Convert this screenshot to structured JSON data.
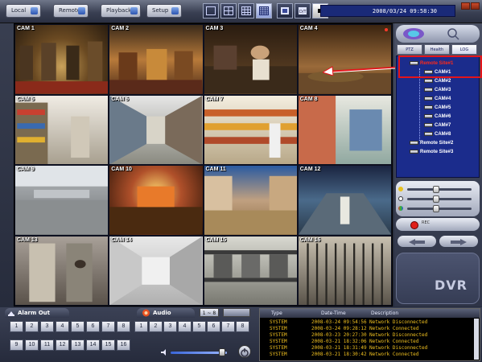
{
  "toolbar": {
    "mode_buttons": [
      "Local",
      "Remote",
      "Playback",
      "Setup"
    ],
    "datetime": "2008/03/24 09:58:30"
  },
  "cameras": [
    "CAM 1",
    "CAM 2",
    "CAM 3",
    "CAM 4",
    "CAM 5",
    "CAM 6",
    "CAM 7",
    "CAM 8",
    "CAM 9",
    "CAM 10",
    "CAM 11",
    "CAM 12",
    "CAM 13",
    "CAM 14",
    "CAM 15",
    "CAM 16"
  ],
  "panel": {
    "tabs": [
      "PTZ",
      "Health Check",
      "LOG"
    ],
    "tree": {
      "root": "Remote Site#1",
      "cams": [
        "CAM#1",
        "CAM#2",
        "CAM#3",
        "CAM#4",
        "CAM#5",
        "CAM#6",
        "CAM#7",
        "CAM#8"
      ],
      "other_sites": [
        "Remote Site#2",
        "Remote Site#3"
      ]
    },
    "sliders": [
      0.45,
      0.45,
      0.45
    ],
    "rec_label": "REC",
    "brand": "DVR"
  },
  "bottom": {
    "alarm_title": "Alarm Out",
    "audio_title": "Audio",
    "page_label": "1 ~ 8",
    "alarm_buttons_row1": [
      "1",
      "2",
      "3",
      "4",
      "5",
      "6",
      "7",
      "8"
    ],
    "alarm_buttons_row2": [
      "9",
      "10",
      "11",
      "12",
      "13",
      "14",
      "15",
      "16"
    ],
    "audio_buttons": [
      "1",
      "2",
      "3",
      "4",
      "5",
      "6",
      "7",
      "8"
    ],
    "audio_volume": 0.92
  },
  "log": {
    "headers": [
      "Type",
      "Date-Time",
      "Description"
    ],
    "rows": [
      [
        "SYSTEM",
        "2008-03-24 09:54:56",
        "Network Disconnected"
      ],
      [
        "SYSTEM",
        "2008-03-24 09:28:12",
        "Network Connected"
      ],
      [
        "SYSTEM",
        "2008-03-23 20:27:30",
        "Network Disconnected"
      ],
      [
        "SYSTEM",
        "2008-03-21 18:32:06",
        "Network Connected"
      ],
      [
        "SYSTEM",
        "2008-03-21 18:31:49",
        "Network Disconnected"
      ],
      [
        "SYSTEM",
        "2008-03-21 18:30:42",
        "Network Connected"
      ]
    ]
  }
}
